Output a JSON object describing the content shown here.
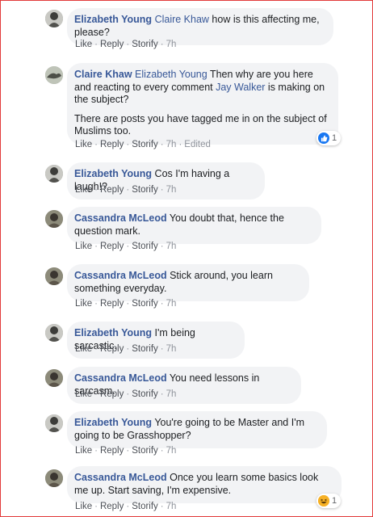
{
  "colors": {
    "link": "#385898",
    "bubble": "#f2f3f5",
    "meta": "#90949c",
    "frame_border": "#e23b3b"
  },
  "actions": {
    "like": "Like",
    "reply": "Reply",
    "storify": "Storify",
    "edited": "Edited"
  },
  "comments": [
    {
      "author": "Elizabeth Young",
      "tag": "Claire Khaw",
      "text": " how is this affecting me, please?",
      "time": "7h"
    },
    {
      "author": "Claire Khaw",
      "tag": "Elizabeth Young",
      "text": " Then why are you here and reacting to every comment ",
      "tag2": "Jay Walker",
      "text2": " is making on the subject?",
      "para2": "There are posts you have tagged me in on the subject of Muslims too.",
      "time": "7h",
      "reaction": {
        "icon": "like-reaction-icon",
        "count": "1"
      }
    },
    {
      "author": "Elizabeth Young",
      "text": " Cos I'm having a laugh!?",
      "time": "7h"
    },
    {
      "author": "Cassandra McLeod",
      "text": " You doubt that, hence the question mark.",
      "time": "7h"
    },
    {
      "author": "Cassandra McLeod",
      "text": " Stick around, you learn something everyday.",
      "time": "7h"
    },
    {
      "author": "Elizabeth Young",
      "text": " I'm being sarcastic.",
      "time": "7h"
    },
    {
      "author": "Cassandra McLeod",
      "text": " You need lessons in sarcasm.",
      "time": "7h"
    },
    {
      "author": "Elizabeth Young",
      "text": " You're going to be Master and I'm going to be Grasshopper?",
      "time": "7h"
    },
    {
      "author": "Cassandra McLeod",
      "text": " Once you learn some basics look me up. Start saving, I'm expensive.",
      "time": "7h",
      "reaction": {
        "icon": "haha-reaction-icon",
        "count": "1"
      }
    }
  ]
}
